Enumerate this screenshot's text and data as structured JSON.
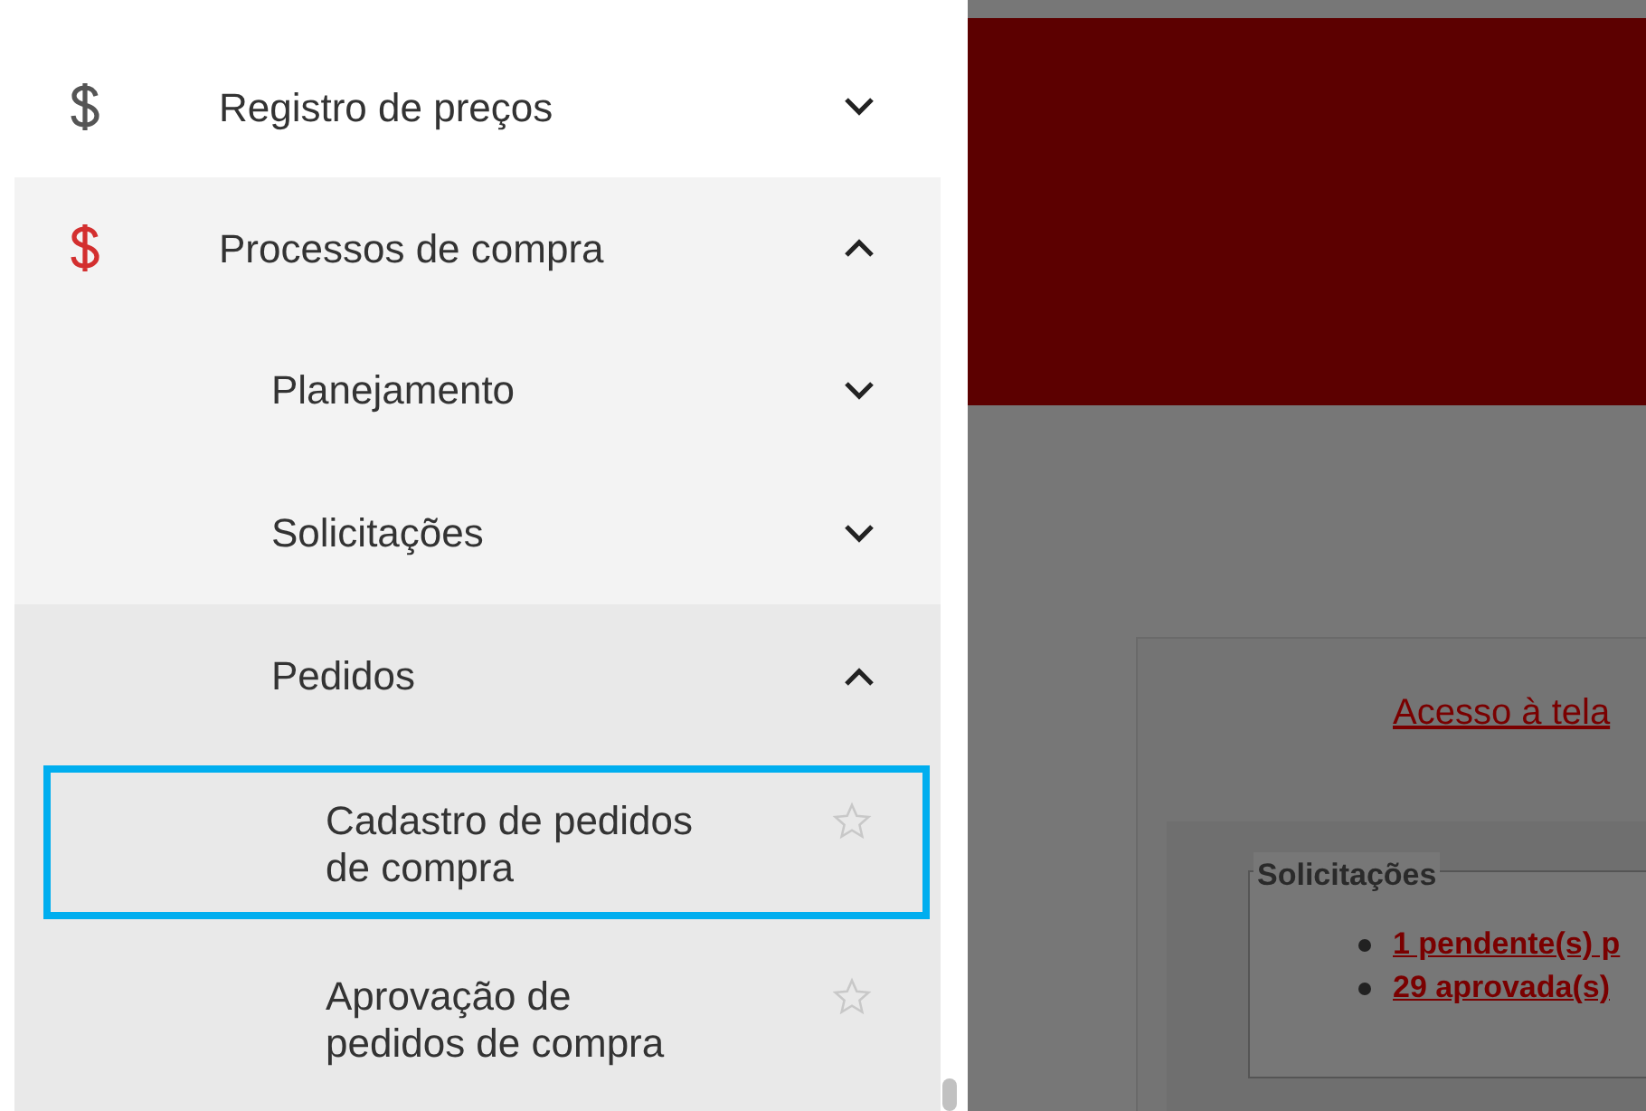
{
  "sidebar": {
    "items": [
      {
        "label": "Registro de preços",
        "active": false,
        "expanded": false
      },
      {
        "label": "Processos de compra",
        "active": true,
        "expanded": true,
        "children": [
          {
            "label": "Planejamento",
            "expanded": false
          },
          {
            "label": "Solicitações",
            "expanded": false
          },
          {
            "label": "Pedidos",
            "expanded": true,
            "children": [
              {
                "label": "Cadastro de pedidos de compra",
                "selected": true,
                "favorite": false
              },
              {
                "label": "Aprovação de pedidos de compra",
                "selected": false,
                "favorite": false
              }
            ]
          }
        ]
      }
    ]
  },
  "main": {
    "link": "Acesso à tela",
    "fieldset": {
      "legend": "Solicitações",
      "items": [
        "1 pendente(s) p",
        "29 aprovada(s)"
      ]
    }
  }
}
